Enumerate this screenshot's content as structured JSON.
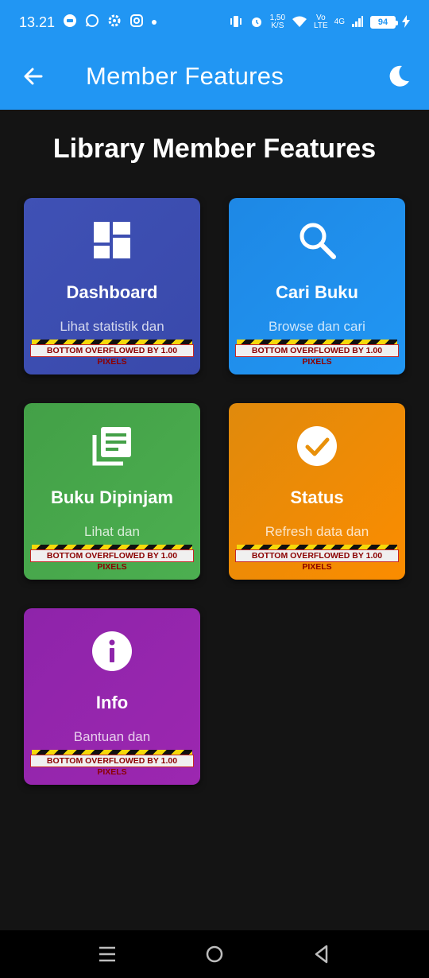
{
  "status_bar": {
    "time": "13.21",
    "speed": "1,50",
    "speed_unit": "K/S",
    "volte_top": "Vo",
    "volte_bottom": "LTE",
    "network": "4G",
    "battery": "94"
  },
  "app_bar": {
    "title": "Member Features",
    "back_icon": "arrow-left-icon",
    "theme_icon": "moon-icon"
  },
  "page": {
    "heading": "Library Member Features"
  },
  "cards": [
    {
      "title": "Dashboard",
      "description": "Lihat statistik dan",
      "icon": "dashboard-icon",
      "overflow": "BOTTOM OVERFLOWED BY 1.00 PIXELS",
      "color_start": "#3f51b5",
      "color_end": "#3949ab"
    },
    {
      "title": "Cari Buku",
      "description": "Browse dan cari",
      "icon": "search-icon",
      "overflow": "BOTTOM OVERFLOWED BY 1.00 PIXELS",
      "color_start": "#1e88e5",
      "color_end": "#2196f3"
    },
    {
      "title": "Buku Dipinjam",
      "description": "Lihat dan",
      "icon": "library-books-icon",
      "overflow": "BOTTOM OVERFLOWED BY 1.00 PIXELS",
      "color_start": "#43a047",
      "color_end": "#4caf50"
    },
    {
      "title": "Status",
      "description": "Refresh data dan",
      "icon": "check-circle-icon",
      "overflow": "BOTTOM OVERFLOWED BY 1.00 PIXELS",
      "color_start": "#e08a0c",
      "color_end": "#fb8c00"
    },
    {
      "title": "Info",
      "description": "Bantuan dan",
      "icon": "info-icon",
      "overflow": "BOTTOM OVERFLOWED BY 1.00 PIXELS",
      "color_start": "#8e24aa",
      "color_end": "#9c27b0"
    }
  ],
  "nav_bar": {
    "menu_icon": "menu-icon",
    "home_icon": "home-circle-icon",
    "back_icon": "back-triangle-icon"
  }
}
